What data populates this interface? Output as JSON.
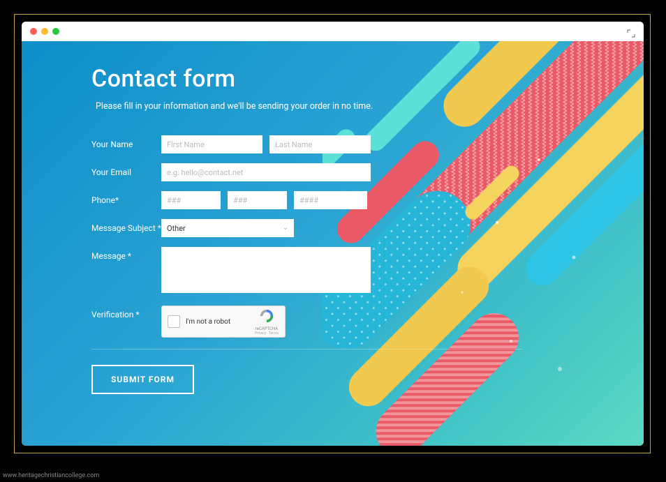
{
  "watermark": "www.heritagechristiancollege.com",
  "page": {
    "title": "Contact form",
    "subtitle": "Please fill in your information and we'll be sending your order in no time."
  },
  "labels": {
    "name": "Your Name",
    "email": "Your Email",
    "phone": "Phone*",
    "subject": "Message Subject *",
    "message": "Message *",
    "verification": "Verification *"
  },
  "placeholders": {
    "first_name": "First Name",
    "last_name": "Last Name",
    "email": "e.g. hello@contact.net",
    "phone1": "###",
    "phone2": "###",
    "phone3": "####"
  },
  "subject": {
    "selected": "Other"
  },
  "recaptcha": {
    "label": "I'm not a robot",
    "brand": "reCAPTCHA",
    "terms": "Privacy - Terms"
  },
  "button": {
    "submit": "SUBMIT FORM"
  }
}
